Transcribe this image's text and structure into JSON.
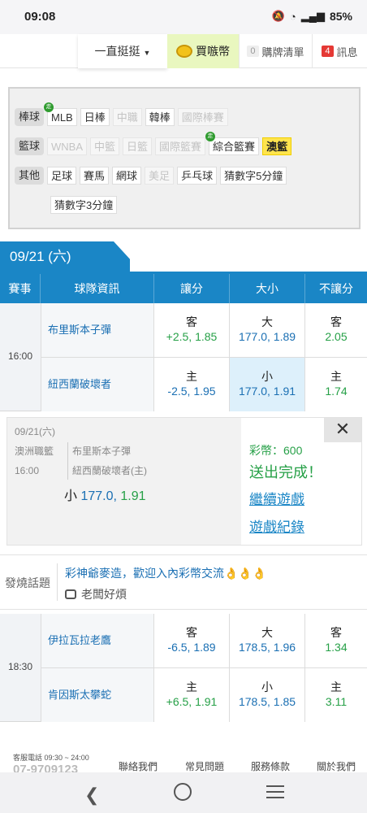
{
  "status_bar": {
    "time": "09:08",
    "battery": "85%"
  },
  "top_nav": {
    "dropdown": "一直挺挺",
    "buy": "買嗾幣",
    "cart_count": "0",
    "cart": "購牌清單",
    "msg_count": "4",
    "msg": "訊息"
  },
  "categories": {
    "baseball": {
      "head": "棒球",
      "items": [
        "MLB",
        "日棒",
        "中職",
        "韓棒",
        "國際棒賽"
      ]
    },
    "basketball": {
      "head": "籃球",
      "items": [
        "WNBA",
        "中籃",
        "日籃",
        "國際籃賽",
        "綜合籃賽",
        "澳籃"
      ]
    },
    "other": {
      "head": "其他",
      "items": [
        "足球",
        "賽馬",
        "網球",
        "美足",
        "乒乓球",
        "猜數字5分鐘",
        "猜數字3分鐘"
      ]
    },
    "new_tag": "走"
  },
  "date_tab": "09/21 (六)",
  "table_header": {
    "event": "賽事",
    "team": "球隊資訊",
    "spread": "讓分",
    "total": "大小",
    "moneyline": "不讓分"
  },
  "games": [
    {
      "time": "16:00",
      "away": {
        "team": "布里斯本子彈",
        "spread_side": "客",
        "spread": "+2.5, 1.85",
        "total_side": "大",
        "total": "177.0, 1.89",
        "ml_side": "客",
        "ml": "2.05"
      },
      "home": {
        "team": "紐西蘭破壞者",
        "spread_side": "主",
        "spread": "-2.5, 1.95",
        "total_side": "小",
        "total": "177.0, 1.91",
        "ml_side": "主",
        "ml": "1.74"
      }
    },
    {
      "time": "18:30",
      "away": {
        "team": "伊拉瓦拉老鷹",
        "spread_side": "客",
        "spread": "-6.5, 1.89",
        "total_side": "大",
        "total": "178.5, 1.96",
        "ml_side": "客",
        "ml": "1.34"
      },
      "home": {
        "team": "肯因斯太攀蛇",
        "spread_side": "主",
        "spread": "+6.5, 1.91",
        "total_side": "小",
        "total": "178.5, 1.85",
        "ml_side": "主",
        "ml": "3.11"
      }
    }
  ],
  "bet_popup": {
    "date": "09/21(六)",
    "league": "澳洲職籃",
    "time": "16:00",
    "team1": "布里斯本子彈",
    "team2": "紐西蘭破壞者(主)",
    "bet_side": "小",
    "bet_value": "177.0,",
    "bet_odds": "1.91",
    "coins": "彩幣：600",
    "done": "送出完成！",
    "continue": "繼續遊戲",
    "history": "遊戲紀錄",
    "close": "✕"
  },
  "hot_topic": {
    "label": "發燒話題",
    "message": "彩神爺麥造，歡迎入內彩幣交流👌👌👌",
    "user": "老闆好煩"
  },
  "footer": {
    "service": "客服電話 09:30 ~ 24:00",
    "phone": "07-9709123",
    "links": [
      "聯絡我們",
      "常見問題",
      "服務條款",
      "關於我們"
    ]
  }
}
